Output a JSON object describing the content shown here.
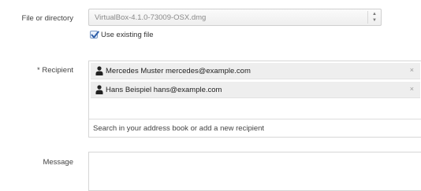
{
  "file_field": {
    "label": "File or directory",
    "selected_value": "VirtualBox-4.1.0-73009-OSX.dmg",
    "use_existing_checked": true,
    "use_existing_label": "Use existing file"
  },
  "recipient_field": {
    "label": "* Recipient",
    "recipients": [
      {
        "text": "Mercedes Muster mercedes@example.com",
        "remove": "×"
      },
      {
        "text": "Hans Beispiel hans@example.com",
        "remove": "×"
      }
    ],
    "search_placeholder": "Search in your address book or add a new recipient"
  },
  "message_field": {
    "label": "Message",
    "value": ""
  },
  "icons": {
    "select_arrows": "updown-arrows-icon",
    "recipient": "person-icon",
    "remove": "close-icon",
    "checkbox": "checkmark-icon"
  },
  "colors": {
    "check_blue": "#2f5fa8",
    "chip_bg": "#eeeeee",
    "border": "#d6d6d6"
  }
}
